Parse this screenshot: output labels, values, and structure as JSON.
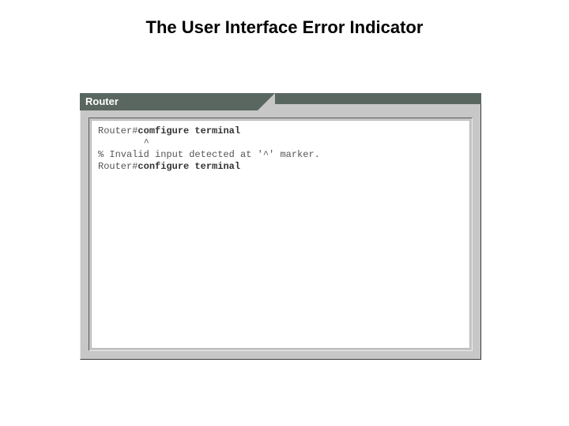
{
  "title": "The User Interface Error Indicator",
  "window": {
    "tab_label": "Router"
  },
  "terminal": {
    "lines": [
      {
        "prompt": "Router#",
        "command": "comfigure terminal",
        "bold_command": true
      },
      {
        "text": "        ^"
      },
      {
        "text": "% Invalid input detected at '^' marker."
      },
      {
        "prompt": "Router#",
        "command": "configure terminal",
        "bold_command": true
      }
    ]
  }
}
